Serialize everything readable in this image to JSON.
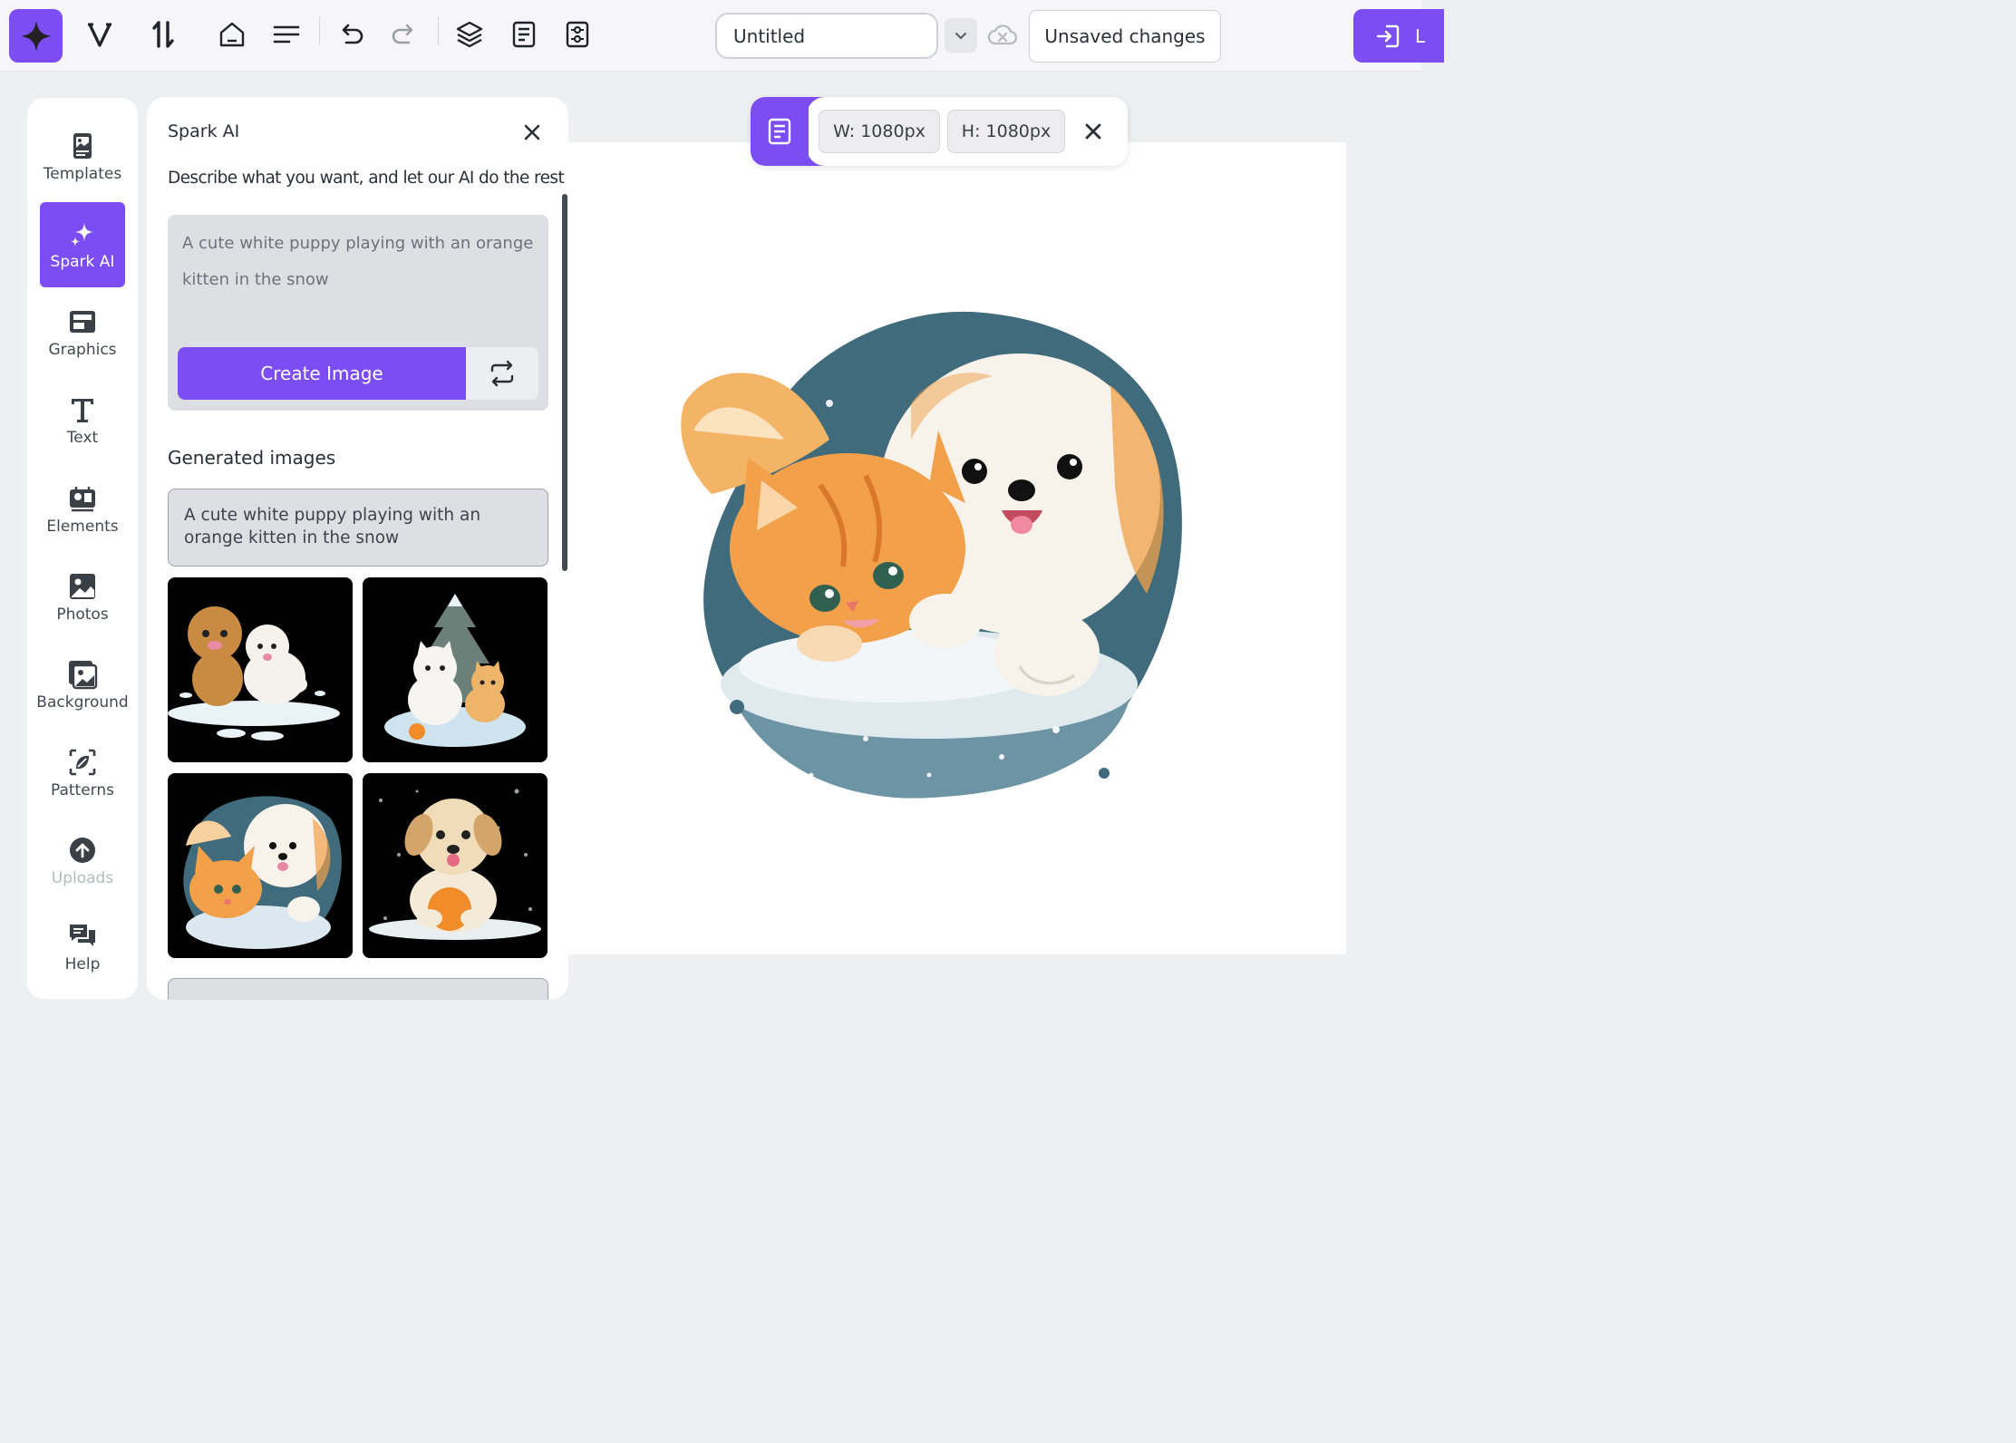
{
  "topbar": {
    "logo_icon": "spark-logo-icon",
    "icons": [
      "vectorize-icon",
      "sort-icon",
      "home-icon",
      "menu-icon",
      "undo-icon",
      "redo-icon",
      "layers-icon",
      "document-icon",
      "settings-sheet-icon"
    ],
    "title_value": "Untitled",
    "dropdown_icon": "chevron-down-icon",
    "cloud_icon": "cloud-off-icon",
    "unsaved_label": "Unsaved changes",
    "login_label": "L"
  },
  "rail": {
    "items": [
      {
        "label": "Templates",
        "icon": "templates-icon"
      },
      {
        "label": "Spark AI",
        "icon": "sparkle-icon",
        "active": true
      },
      {
        "label": "Graphics",
        "icon": "graphics-icon"
      },
      {
        "label": "Text",
        "icon": "text-icon"
      },
      {
        "label": "Elements",
        "icon": "elements-icon"
      },
      {
        "label": "Photos",
        "icon": "photos-icon"
      },
      {
        "label": "Background",
        "icon": "background-icon"
      },
      {
        "label": "Patterns",
        "icon": "patterns-icon"
      },
      {
        "label": "Uploads",
        "icon": "upload-icon"
      },
      {
        "label": "Help",
        "icon": "help-icon"
      }
    ]
  },
  "spark": {
    "title": "Spark AI",
    "description": "Describe what you want, and let our AI do the rest",
    "prompt_value": "A cute white puppy playing with an orange kitten in the snow",
    "create_label": "Create Image",
    "generated_heading": "Generated images",
    "generated_prompt": "A cute white puppy playing with an orange kitten in the snow"
  },
  "canvas": {
    "width_label": "W: 1080px",
    "height_label": "H: 1080px"
  },
  "colors": {
    "accent": "#7b4df2",
    "snow_blue": "#3f6b7c",
    "fur_orange": "#f2a04a",
    "fur_white": "#f7f2ea"
  }
}
